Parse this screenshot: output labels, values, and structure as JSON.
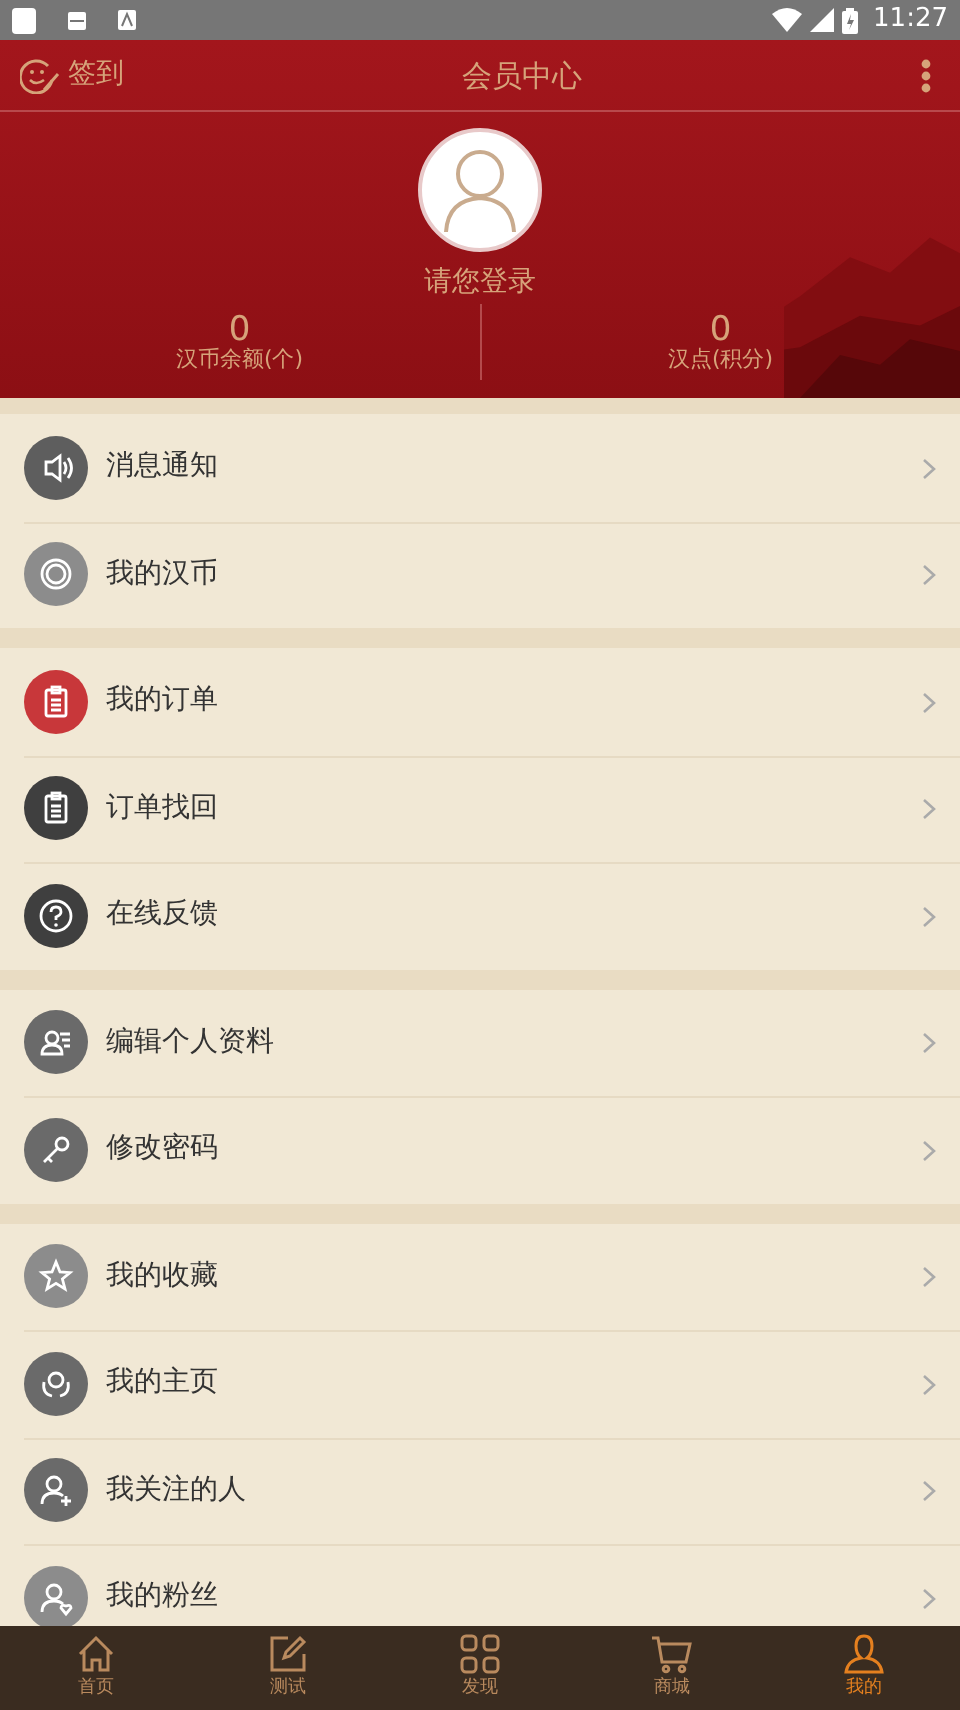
{
  "status_bar": {
    "time": "11:27"
  },
  "header": {
    "checkin": "签到",
    "title": "会员中心",
    "login": "请您登录",
    "stats": [
      {
        "value": "0",
        "label": "汉币余额(个)"
      },
      {
        "value": "0",
        "label": "汉点(积分)"
      }
    ]
  },
  "sections": [
    {
      "items": [
        {
          "label": "消息通知",
          "kind": "speaker",
          "color": "#5e5e5e"
        },
        {
          "label": "我的汉币",
          "kind": "coin",
          "color": "#8c8c8c"
        }
      ]
    },
    {
      "items": [
        {
          "label": "我的订单",
          "kind": "clipboard",
          "color": "#c8373a"
        },
        {
          "label": "订单找回",
          "kind": "clipboard",
          "color": "#3f3f3f"
        },
        {
          "label": "在线反馈",
          "kind": "question",
          "color": "#3f3f3f"
        }
      ]
    },
    {
      "items": [
        {
          "label": "编辑个人资料",
          "kind": "profile",
          "color": "#6a6a6a"
        },
        {
          "label": "修改密码",
          "kind": "key",
          "color": "#6a6a6a"
        }
      ]
    },
    {
      "items": [
        {
          "label": "我的收藏",
          "kind": "star",
          "color": "#8c8c8c"
        },
        {
          "label": "我的主页",
          "kind": "hands",
          "color": "#6a6a6a"
        },
        {
          "label": "我关注的人",
          "kind": "follow",
          "color": "#6a6a6a"
        },
        {
          "label": "我的粉丝",
          "kind": "fans",
          "color": "#8c8c8c"
        }
      ]
    }
  ],
  "tabs": [
    {
      "label": "首页",
      "kind": "home",
      "selected": false
    },
    {
      "label": "测试",
      "kind": "edit",
      "selected": false
    },
    {
      "label": "发现",
      "kind": "grid",
      "selected": false
    },
    {
      "label": "商城",
      "kind": "cart",
      "selected": false
    },
    {
      "label": "我的",
      "kind": "person",
      "selected": true
    }
  ]
}
